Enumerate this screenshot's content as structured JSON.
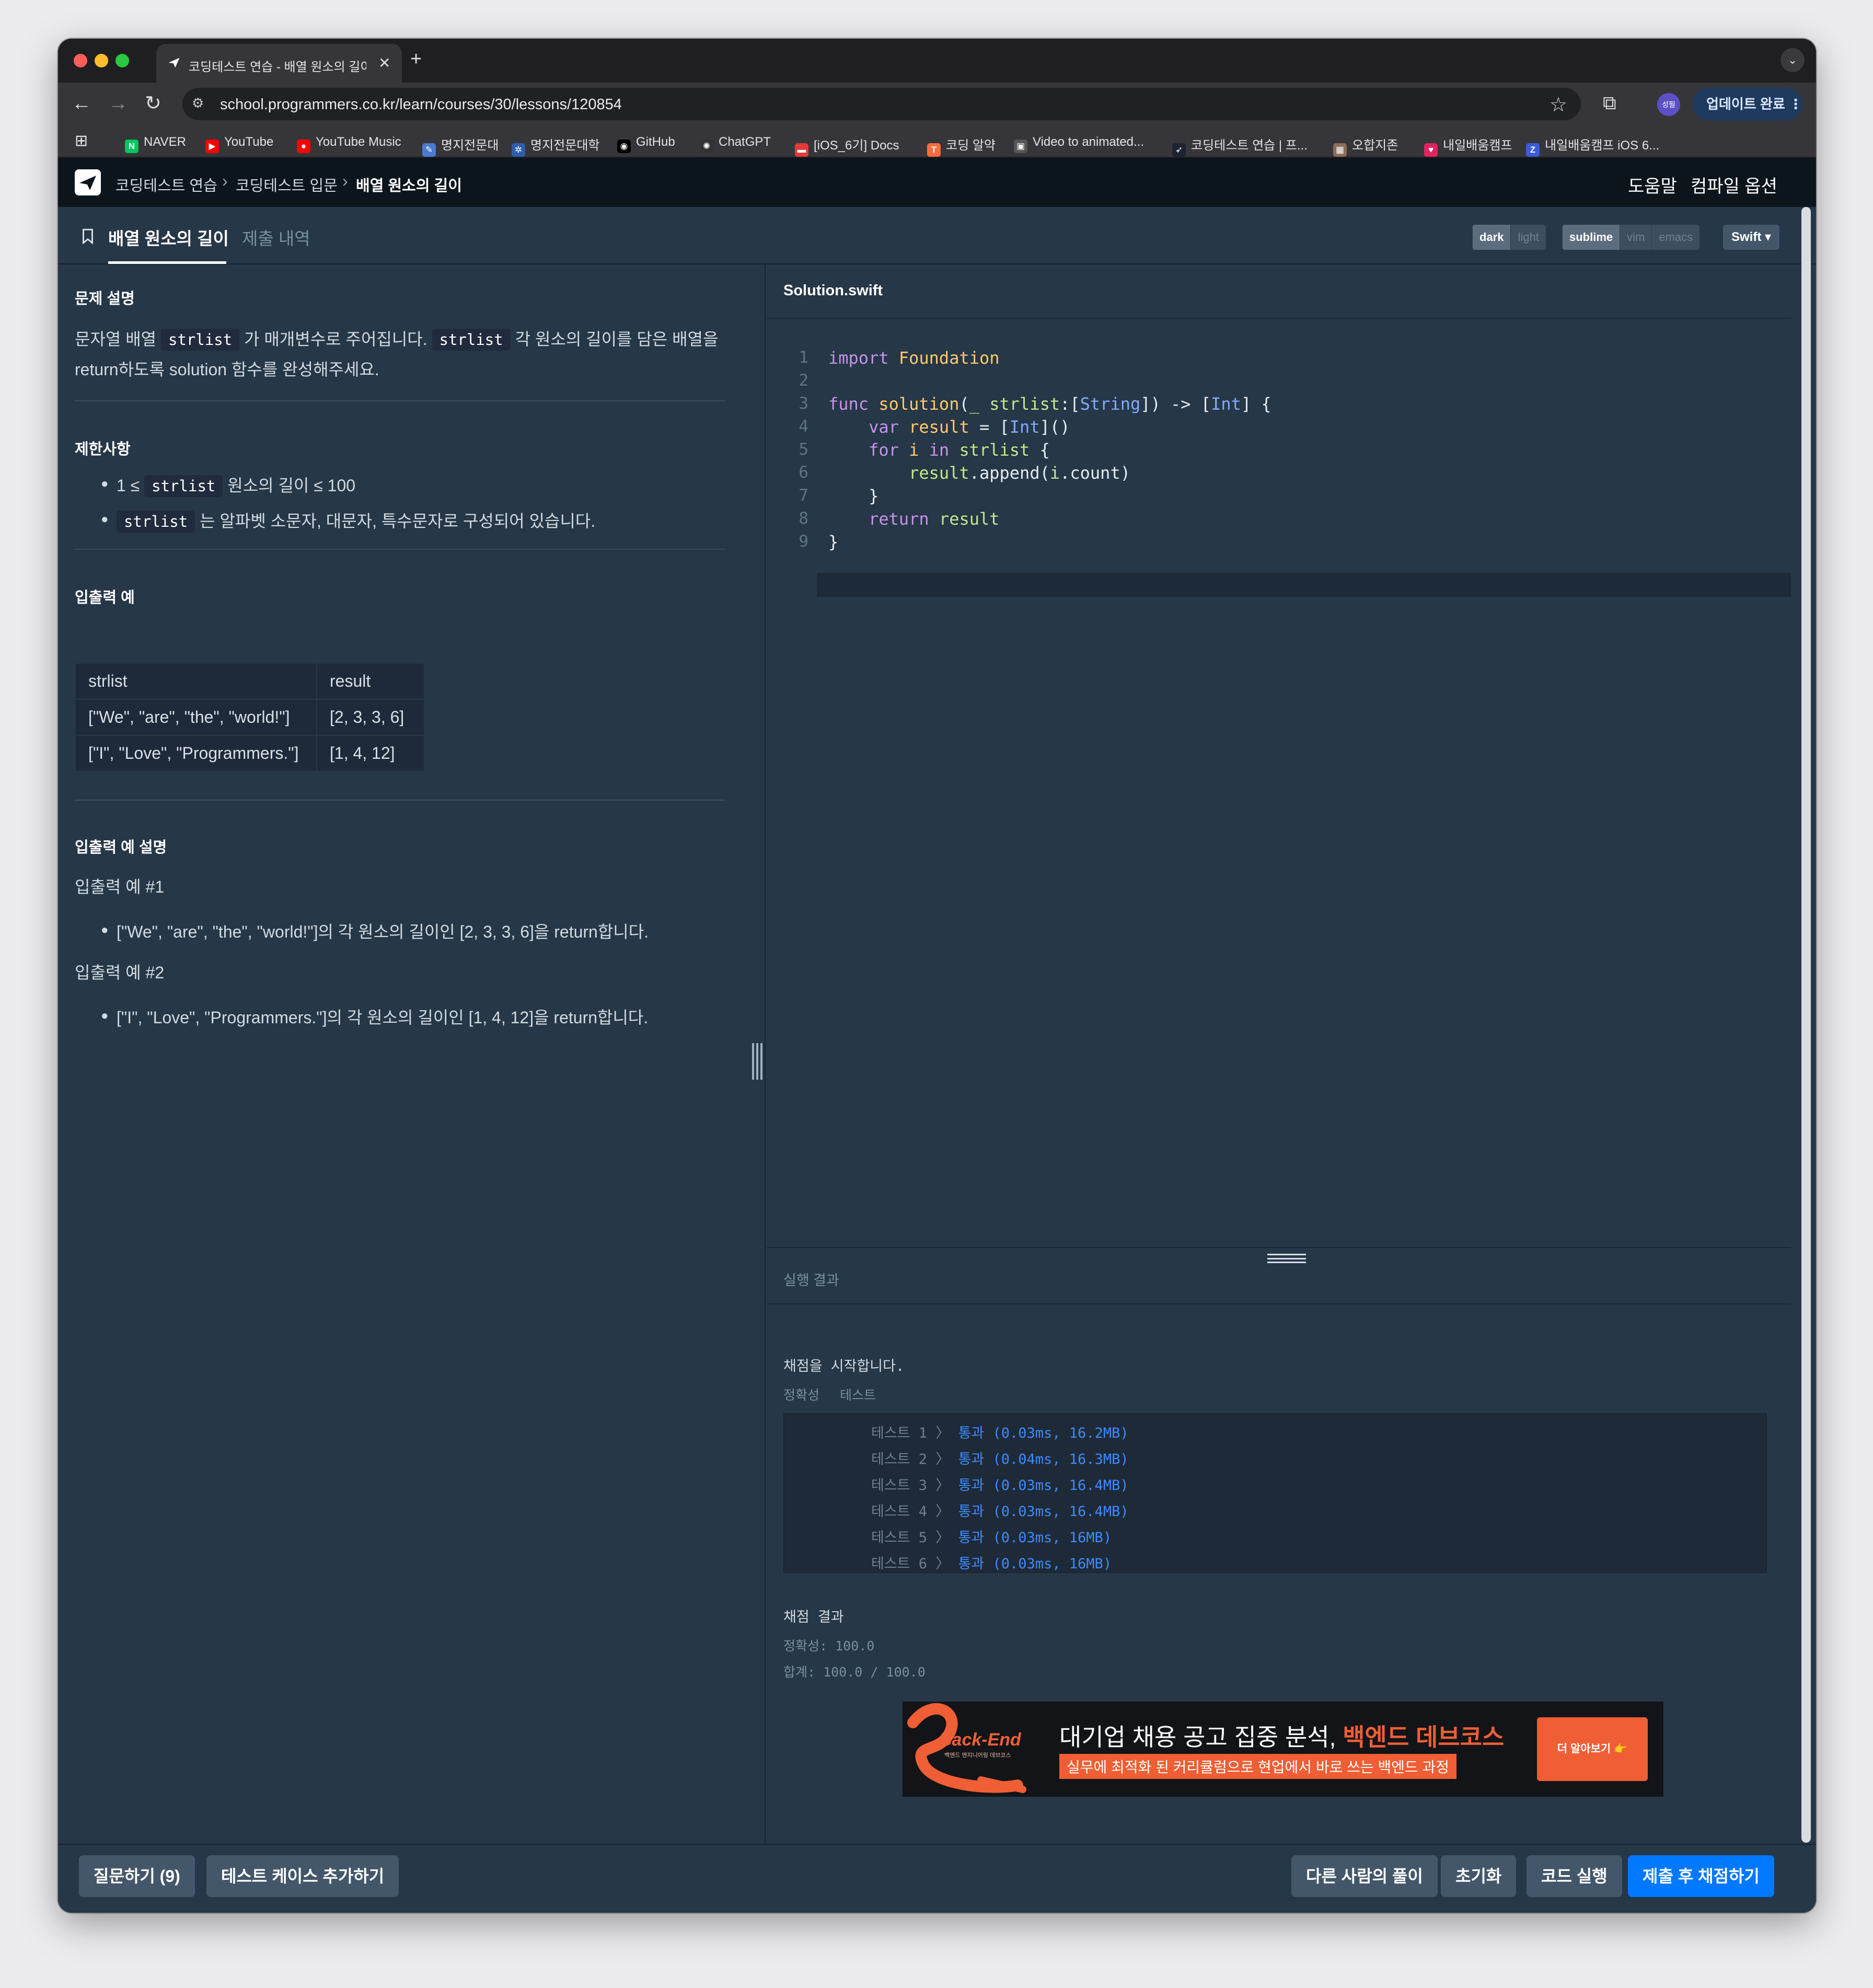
{
  "browser": {
    "tab_title": "코딩테스트 연습 - 배열 원소의 길이",
    "url": "school.programmers.co.kr/learn/courses/30/lessons/120854",
    "profile_label": "성필",
    "update_label": "업데이트 완료",
    "bookmarks": [
      {
        "label": "NAVER",
        "icon": "naver-icon",
        "color": "#03c75a",
        "glyph": "N"
      },
      {
        "label": "YouTube",
        "icon": "youtube-icon",
        "color": "#ff0000",
        "glyph": "▶"
      },
      {
        "label": "YouTube Music",
        "icon": "youtube-music-icon",
        "color": "#ff0000",
        "glyph": "●"
      },
      {
        "label": "명지전문대",
        "icon": "note-icon",
        "color": "#4a7bd1",
        "glyph": "✎"
      },
      {
        "label": "명지전문대학",
        "icon": "dots-icon",
        "color": "#2e5eaa",
        "glyph": "✲"
      },
      {
        "label": "GitHub",
        "icon": "github-icon",
        "color": "#000000",
        "glyph": "◉"
      },
      {
        "label": "ChatGPT",
        "icon": "chatgpt-icon",
        "color": "#333333",
        "glyph": "✺"
      },
      {
        "label": "[iOS_6기] Docs",
        "icon": "docs-icon",
        "color": "#e53935",
        "glyph": "▬"
      },
      {
        "label": "코딩 알약",
        "icon": "pill-icon",
        "color": "#ff6b3d",
        "glyph": "T"
      },
      {
        "label": "Video to animated...",
        "icon": "video-icon",
        "color": "#555555",
        "glyph": "▣"
      },
      {
        "label": "코딩테스트 연습 | 프...",
        "icon": "programmers-icon",
        "color": "#1c2331",
        "glyph": "➶"
      },
      {
        "label": "오합지존",
        "icon": "photo-icon",
        "color": "#8a6d5a",
        "glyph": "▦"
      },
      {
        "label": "내일배움캠프",
        "icon": "heart-icon",
        "color": "#e0245e",
        "glyph": "♥"
      },
      {
        "label": "내일배움캠프 iOS 6...",
        "icon": "z-icon",
        "color": "#3b5bdb",
        "glyph": "Z"
      }
    ]
  },
  "header": {
    "breadcrumbs": [
      "코딩테스트 연습",
      "코딩테스트 입문",
      "배열 원소의 길이"
    ],
    "help": "도움말",
    "compile_options": "컴파일 옵션"
  },
  "subheader": {
    "tab_problem": "배열 원소의 길이",
    "tab_submissions": "제출 내역",
    "theme": {
      "dark": "dark",
      "light": "light"
    },
    "keymap": {
      "sublime": "sublime",
      "vim": "vim",
      "emacs": "emacs"
    },
    "language": "Swift"
  },
  "problem": {
    "desc_title": "문제 설명",
    "desc_p1": "가 매개변수로 주어집니다.",
    "desc_p1_pre": "문자열 배열",
    "desc_p1_post": "각 원소의 길이를 담은 배열을",
    "desc_p2": "return하도록 solution 함수를 완성해주세요.",
    "code_strlist": "strlist",
    "limits_title": "제한사항",
    "limit1_pre": "1 ≤",
    "limit1_post": "원소의 길이 ≤ 100",
    "limit2_post": "는 알파벳 소문자, 대문자, 특수문자로 구성되어 있습니다.",
    "io_title": "입출력 예",
    "io_table": {
      "headers": [
        "strlist",
        "result"
      ],
      "rows": [
        [
          "[\"We\", \"are\", \"the\", \"world!\"]",
          "[2, 3, 3, 6]"
        ],
        [
          "[\"I\", \"Love\", \"Programmers.\"]",
          "[1, 4, 12]"
        ]
      ]
    },
    "io_desc_title": "입출력 예 설명",
    "ex1_title": "입출력 예 #1",
    "ex1_text": "[\"We\", \"are\", \"the\", \"world!\"]의 각 원소의 길이인 [2, 3, 3, 6]을 return합니다.",
    "ex2_title": "입출력 예 #2",
    "ex2_text": "[\"I\", \"Love\", \"Programmers.\"]의 각 원소의 길이인 [1, 4, 12]을 return합니다."
  },
  "editor": {
    "filename": "Solution.swift",
    "line_numbers": [
      "1",
      "2",
      "3",
      "4",
      "5",
      "6",
      "7",
      "8",
      "9"
    ]
  },
  "result": {
    "header": "실행 결과",
    "start_msg": "채점을 시작합니다.",
    "col_accuracy": "정확성",
    "col_test": "테스트",
    "tests": [
      {
        "label": "테스트 1 〉",
        "result": "통과 (0.03ms, 16.2MB)"
      },
      {
        "label": "테스트 2 〉",
        "result": "통과 (0.04ms, 16.3MB)"
      },
      {
        "label": "테스트 3 〉",
        "result": "통과 (0.03ms, 16.4MB)"
      },
      {
        "label": "테스트 4 〉",
        "result": "통과 (0.03ms, 16.4MB)"
      },
      {
        "label": "테스트 5 〉",
        "result": "통과 (0.03ms, 16MB)"
      },
      {
        "label": "테스트 6 〉",
        "result": "통과 (0.03ms, 16MB)"
      }
    ],
    "score_title": "채점 결과",
    "accuracy_line": "정확성: 100.0",
    "total_line": "합계: 100.0 / 100.0"
  },
  "banner": {
    "logo_text": "Back-End",
    "logo_sub": "백엔드 엔지니어링 데브코스",
    "headline_pre": "대기업 채용 공고 집중 분석,",
    "headline_hl": "백엔드 데브코스",
    "sub": "실무에 최적화 된 커리큘럼으로 현업에서 바로 쓰는 백엔드 과정",
    "cta": "더 알아보기 👉"
  },
  "actions": {
    "ask": "질문하기 (9)",
    "add_testcase": "테스트 케이스 추가하기",
    "others": "다른 사람의 풀이",
    "reset": "초기화",
    "run": "코드 실행",
    "submit": "제출 후 채점하기"
  }
}
